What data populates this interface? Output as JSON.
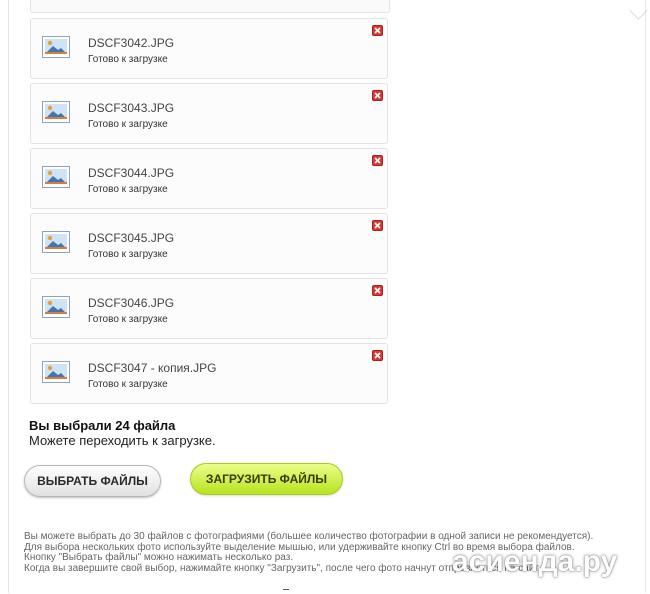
{
  "files": [
    {
      "name": "DSCF3042.JPG",
      "status": "Готово к загрузке",
      "icon": "image-file-icon"
    },
    {
      "name": "DSCF3043.JPG",
      "status": "Готово к загрузке",
      "icon": "image-file-icon"
    },
    {
      "name": "DSCF3044.JPG",
      "status": "Готово к загрузке",
      "icon": "image-file-icon"
    },
    {
      "name": "DSCF3045.JPG",
      "status": "Готово к загрузке",
      "icon": "image-file-icon"
    },
    {
      "name": "DSCF3046.JPG",
      "status": "Готово к загрузке",
      "icon": "image-file-icon"
    },
    {
      "name": "DSCF3047 - копия.JPG",
      "status": "Готово к загрузке",
      "icon": "image-file-icon"
    }
  ],
  "summary": {
    "title": "Вы выбрали 24 файла",
    "subtitle": "Можете переходить к загрузке."
  },
  "buttons": {
    "select_label": "ВЫБРАТЬ ФАЙЛЫ",
    "upload_label": "ЗАГРУЗИТЬ ФАЙЛЫ"
  },
  "instructions": [
    "Вы можете выбрать до 30 файлов с фотографиями (большее количество фотографии в одной записи не рекомендуется).",
    "Для выбора нескольких фото используйте выделение мышью, или удерживайте кнопку Ctrl во время выбора файлов.",
    "Кнопку \"Выбрать файлы\" можно нажимать несколько раз.",
    "Когда вы завершите свой выбор, нажимайте кнопку \"Загрузить\", после чего фото начнут отправляться на сайт."
  ],
  "watermark": "асиенда.ру",
  "colors": {
    "remove_red": "#d53a34",
    "upload_green": "#b7e31f",
    "border": "#e3e3e3"
  }
}
